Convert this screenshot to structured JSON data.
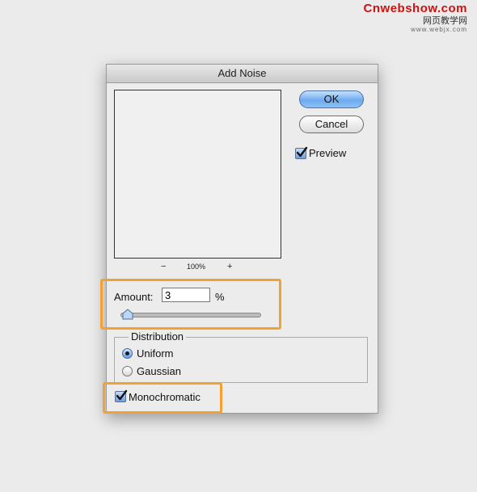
{
  "watermark": {
    "brand": "Cnwebshow.com",
    "chinese": "网页教学网",
    "url": "www.webjx.com"
  },
  "dialog": {
    "title": "Add Noise",
    "ok_label": "OK",
    "cancel_label": "Cancel",
    "preview_label": "Preview",
    "preview_checked": true,
    "zoom": {
      "minus": "−",
      "level": "100%",
      "plus": "+"
    },
    "amount": {
      "label": "Amount:",
      "value": "3",
      "unit": "%",
      "slider_fraction": 0.03
    },
    "distribution": {
      "legend": "Distribution",
      "options": [
        {
          "label": "Uniform",
          "selected": true
        },
        {
          "label": "Gaussian",
          "selected": false
        }
      ]
    },
    "monochromatic_label": "Monochromatic",
    "monochromatic_checked": true
  },
  "colors": {
    "highlight": "#f5a033",
    "ok_button": "#6eaaf0",
    "watermark_red": "#d01010"
  },
  "icons": [
    "checkmark-icon",
    "slider-thumb-icon"
  ]
}
